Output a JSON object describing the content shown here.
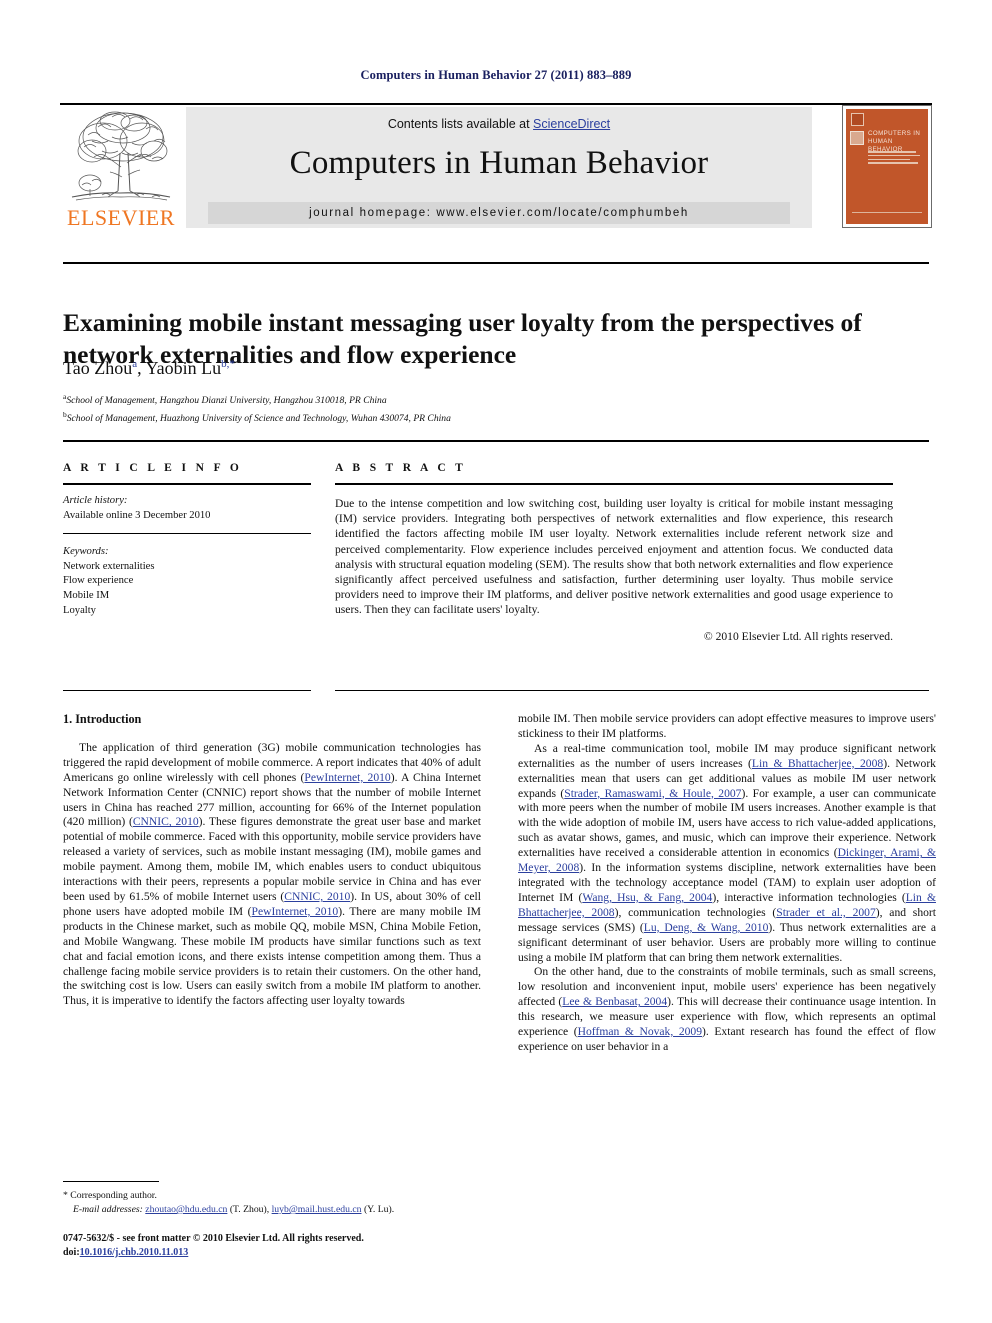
{
  "running_head": "Computers in Human Behavior 27 (2011) 883–889",
  "masthead": {
    "contents_prefix": "Contents lists available at ",
    "sciencedirect": "ScienceDirect",
    "journal_name": "Computers in Human Behavior",
    "homepage": "journal homepage: www.elsevier.com/locate/comphumbeh",
    "publisher": "ELSEVIER",
    "cover_title": "COMPUTERS IN HUMAN BEHAVIOR",
    "colors": {
      "elsevier_orange": "#ef7622",
      "cover_orange": "#c1562a",
      "link_blue": "#2b3f9e",
      "running_head_blue": "#1a2060",
      "box_gray": "#e8e8e8",
      "bar_gray": "#d6d6d6"
    }
  },
  "article": {
    "title": "Examining mobile instant messaging user loyalty from the perspectives of network externalities and flow experience",
    "authors": "Tao Zhou ᵃ, Yaobin Lu ᵇ,*",
    "author_1": "Tao Zhou",
    "author_1_sup": "a",
    "author_2": "Yaobin Lu",
    "author_2_sup": "b,*",
    "affiliation_a": "School of Management, Hangzhou Dianzi University, Hangzhou 310018, PR China",
    "affiliation_a_sup": "a",
    "affiliation_b": "School of Management, Huazhong University of Science and Technology, Wuhan 430074, PR China",
    "affiliation_b_sup": "b"
  },
  "article_info": {
    "heading": "A R T I C L E   I N F O",
    "history_label": "Article history:",
    "history_value": "Available online 3 December 2010",
    "keywords_label": "Keywords:",
    "keywords": [
      "Network externalities",
      "Flow experience",
      "Mobile IM",
      "Loyalty"
    ]
  },
  "abstract": {
    "heading": "A B S T R A C T",
    "body": "Due to the intense competition and low switching cost, building user loyalty is critical for mobile instant messaging (IM) service providers. Integrating both perspectives of network externalities and flow experience, this research identified the factors affecting mobile IM user loyalty. Network externalities include referent network size and perceived complementarity. Flow experience includes perceived enjoyment and attention focus. We conducted data analysis with structural equation modeling (SEM). The results show that both network externalities and flow experience significantly affect perceived usefulness and satisfaction, further determining user loyalty. Thus mobile service providers need to improve their IM platforms, and deliver positive network externalities and good usage experience to users. Then they can facilitate users' loyalty.",
    "copyright": "© 2010 Elsevier Ltd. All rights reserved."
  },
  "body": {
    "section_1_heading": "1. Introduction",
    "left_para_1_parts": [
      "The application of third generation (3G) mobile communication technologies has triggered the rapid development of mobile commerce. A report indicates that 40% of adult Americans go online wirelessly with cell phones (",
      "PewInternet, 2010",
      "). A China Internet Network Information Center (CNNIC) report shows that the number of mobile Internet users in China has reached 277 million, accounting for 66% of the Internet population (420 million) (",
      "CNNIC, 2010",
      "). These figures demonstrate the great user base and market potential of mobile commerce. Faced with this opportunity, mobile service providers have released a variety of services, such as mobile instant messaging (IM), mobile games and mobile payment. Among them, mobile IM, which enables users to conduct ubiquitous interactions with their peers, represents a popular mobile service in China and has ever been used by 61.5% of mobile Internet users (",
      "CNNIC, 2010",
      "). In US, about 30% of cell phone users have adopted mobile IM (",
      "PewInternet, 2010",
      "). There are many mobile IM products in the Chinese market, such as mobile QQ, mobile MSN, China Mobile Fetion, and Mobile Wangwang. These mobile IM products have similar functions such as text chat and facial emotion icons, and there exists intense competition among them. Thus a challenge facing mobile service providers is to retain their customers. On the other hand, the switching cost is low. Users can easily switch from a mobile IM platform to another. Thus, it is imperative to identify the factors affecting user loyalty towards"
    ],
    "right_para_1": "mobile IM. Then mobile service providers can adopt effective measures to improve users' stickiness to their IM platforms.",
    "right_para_2_parts": [
      "As a real-time communication tool, mobile IM may produce significant network externalities as the number of users increases (",
      "Lin & Bhattacherjee, 2008",
      "). Network externalities mean that users can get additional values as mobile IM user network expands (",
      "Strader, Ramaswami, & Houle, 2007",
      "). For example, a user can communicate with more peers when the number of mobile IM users increases. Another example is that with the wide adoption of mobile IM, users have access to rich value-added applications, such as avatar shows, games, and music, which can improve their experience. Network externalities have received a considerable attention in economics (",
      "Dickinger, Arami, & Meyer, 2008",
      "). In the information systems discipline, network externalities have been integrated with the technology acceptance model (TAM) to explain user adoption of Internet IM (",
      "Wang, Hsu, & Fang, 2004",
      "), interactive information technologies (",
      "Lin & Bhattacherjee, 2008",
      "), communication technologies (",
      "Strader et al., 2007",
      "), and short message services (SMS) (",
      "Lu, Deng, & Wang, 2010",
      "). Thus network externalities are a significant determinant of user behavior. Users are probably more willing to continue using a mobile IM platform that can bring them network externalities."
    ],
    "right_para_3_parts": [
      "On the other hand, due to the constraints of mobile terminals, such as small screens, low resolution and inconvenient input, mobile users' experience has been negatively affected (",
      "Lee & Benbasat, 2004",
      "). This will decrease their continuance usage intention. In this research, we measure user experience with flow, which represents an optimal experience (",
      "Hoffman & Novak, 2009",
      "). Extant research has found the effect of flow experience on user behavior in a"
    ]
  },
  "footnote": {
    "corresponding": "* Corresponding author.",
    "emails_label": "E-mail addresses:",
    "email_1": "zhoutao@hdu.edu.cn",
    "email_1_who": " (T. Zhou), ",
    "email_2": "luyb@mail.hust.edu.cn",
    "email_2_who": " (Y. Lu)."
  },
  "issn": {
    "line_1": "0747-5632/$ - see front matter © 2010 Elsevier Ltd. All rights reserved.",
    "doi_label": "doi:",
    "doi_value": "10.1016/j.chb.2010.11.013"
  }
}
